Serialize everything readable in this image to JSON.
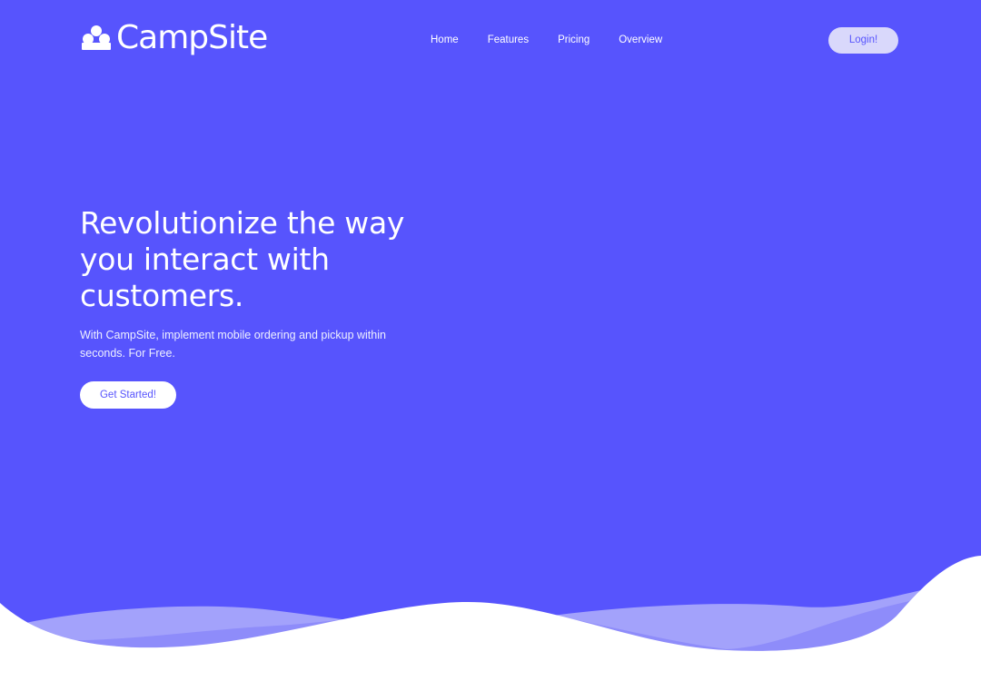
{
  "brand": {
    "name": "CampSite",
    "logo_icon": "people-group-icon"
  },
  "nav": {
    "items": [
      {
        "label": "Home"
      },
      {
        "label": "Features"
      },
      {
        "label": "Pricing"
      },
      {
        "label": "Overview"
      }
    ],
    "login_label": "Login!"
  },
  "hero": {
    "headline": "Revolutionize the way you interact with customers.",
    "subtext": "With CampSite, implement mobile ordering and pickup within seconds. For Free.",
    "cta_label": "Get Started!"
  },
  "colors": {
    "primary": "#5754fd",
    "login_button_bg": "#d9d8fb",
    "white": "#ffffff"
  }
}
